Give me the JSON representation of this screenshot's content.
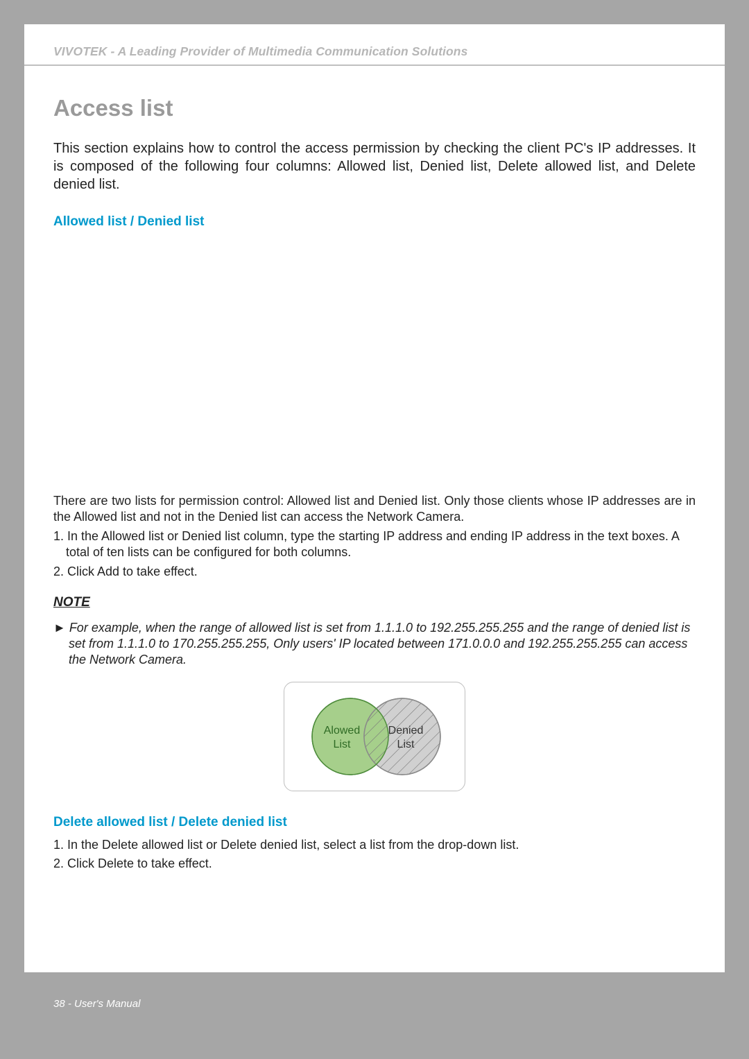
{
  "header": {
    "brandline": "VIVOTEK - A Leading Provider of Multimedia Communication Solutions"
  },
  "title": "Access list",
  "intro": "This section explains how to control the access permission by checking the client PC's IP addresses. It is composed of the following four columns: Allowed list, Denied list, Delete allowed list, and Delete denied list.",
  "sub1": "Allowed list / Denied list",
  "para1": "There are two lists for permission control: Allowed list and Denied list. Only those clients whose IP addresses are in the Allowed list and not in the Denied list can access the Network Camera.",
  "step1": "1. In the Allowed list or Denied list column, type the starting IP address and ending IP address in the text boxes. A total of ten lists can be configured for both columns.",
  "step2": "2. Click Add to take effect.",
  "noteLabel": "NOTE",
  "noteBody": "► For example, when the range of allowed list is set from 1.1.1.0 to 192.255.255.255 and the range of denied list is set from 1.1.1.0 to 170.255.255.255, Only users' IP located between 171.0.0.0 and 192.255.255.255 can access the Network Camera.",
  "venn": {
    "allowedLabel1": "Alowed",
    "allowedLabel2": "List",
    "deniedLabel1": "Denied",
    "deniedLabel2": "List"
  },
  "sub2": "Delete allowed list / Delete denied list",
  "del1": "1. In the Delete allowed list or Delete denied list, select a list from the drop-down list.",
  "del2": "2. Click Delete to take effect.",
  "footer": "38 - User's Manual"
}
